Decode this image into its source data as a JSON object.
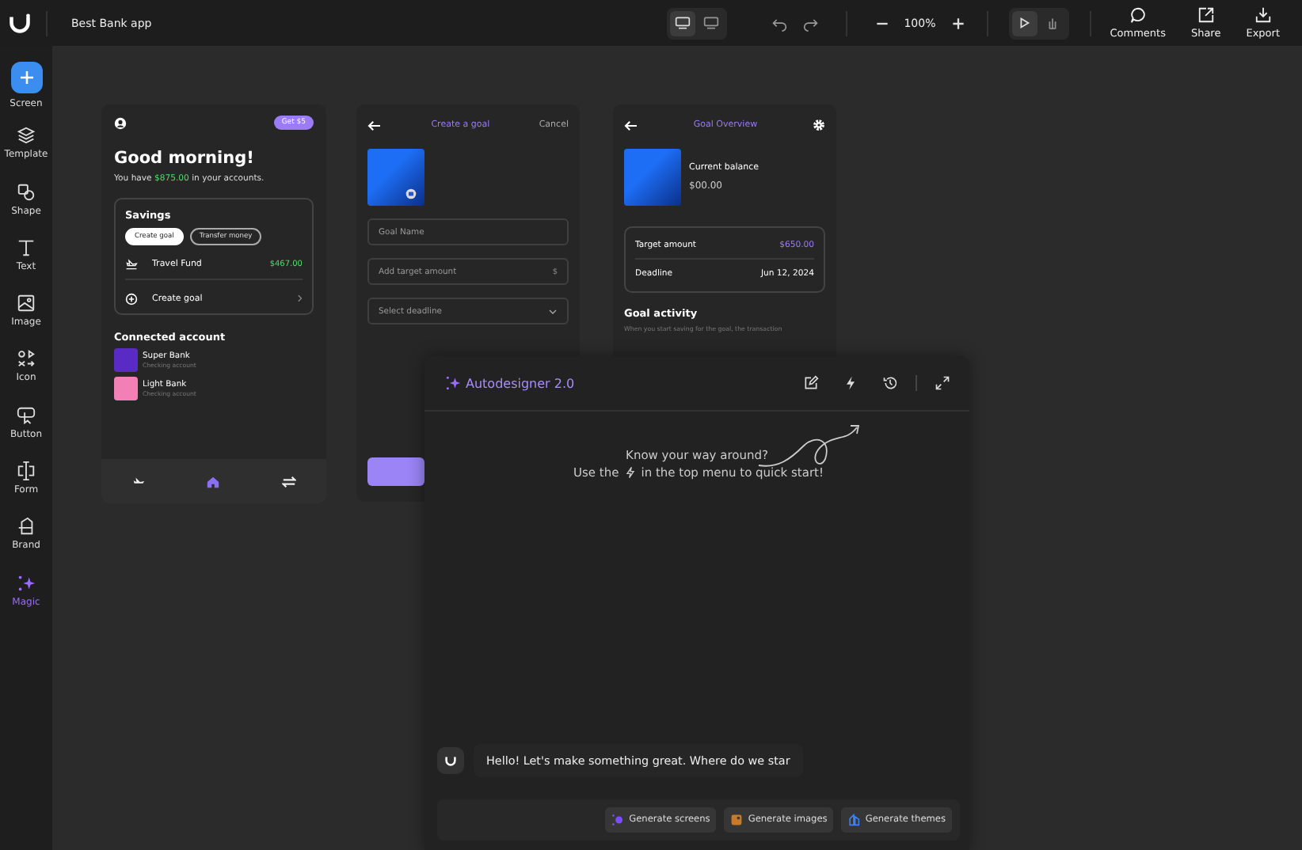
{
  "app": {
    "title": "Best Bank app"
  },
  "toolbar": {
    "views": [
      {
        "selected": true
      },
      {
        "selected": false
      }
    ],
    "zoom": "100%",
    "modes": [
      {
        "selected": true
      },
      {
        "selected": false
      }
    ],
    "actions": [
      {
        "label": "Comments"
      },
      {
        "label": "Share"
      },
      {
        "label": "Export"
      }
    ]
  },
  "sidebar": {
    "items": [
      {
        "label": "Screen",
        "selected": false
      },
      {
        "label": "Template",
        "selected": false
      },
      {
        "label": "Shape",
        "selected": false
      },
      {
        "label": "Text",
        "selected": false
      },
      {
        "label": "Image",
        "selected": false
      },
      {
        "label": "Icon",
        "selected": false
      },
      {
        "label": "Button",
        "selected": false
      },
      {
        "label": "Form",
        "selected": false
      },
      {
        "label": "Brand",
        "selected": false
      },
      {
        "label": "Magic",
        "selected": true
      }
    ]
  },
  "home_screen": {
    "badge": "Get $5",
    "greeting": "Good morning!",
    "balance_prefix": "You have ",
    "balance": "$875.00",
    "balance_suffix": " in your accounts.",
    "savings": {
      "title": "Savings",
      "chips": [
        {
          "label": "Create goal",
          "selected": true
        },
        {
          "label": "Transfer money",
          "selected": false
        }
      ],
      "goal": {
        "name": "Travel Fund",
        "amount": "$467.00"
      },
      "create": "Create goal"
    },
    "connected_title": "Connected account",
    "accounts": [
      {
        "name": "Super Bank",
        "type": "Checking account",
        "color": "#5a2bc4"
      },
      {
        "name": "Light Bank",
        "type": "Checking account",
        "color": "#f27fb5"
      }
    ],
    "nav": [
      {
        "selected": false
      },
      {
        "selected": true
      },
      {
        "selected": false
      }
    ]
  },
  "create_goal_screen": {
    "title": "Create a goal",
    "cancel": "Cancel",
    "fields": [
      {
        "placeholder": "Goal Name",
        "kind": "text"
      },
      {
        "placeholder": "Add target amount",
        "suffix": "$",
        "kind": "amount"
      },
      {
        "placeholder": "Select deadline",
        "kind": "select"
      }
    ]
  },
  "goal_overview_screen": {
    "title": "Goal Overview",
    "balance_label": "Current balance",
    "balance": "$00.00",
    "details": [
      {
        "label": "Target amount",
        "value": "$650.00",
        "kind": "accent"
      },
      {
        "label": "Deadline",
        "value": "Jun 12, 2024",
        "kind": "plain"
      }
    ],
    "activity_title": "Goal activity",
    "activity_text": "When you start saving for the goal, the transaction"
  },
  "autodesigner": {
    "title": "Autodesigner 2.0",
    "hint_question": "Know your way around?",
    "hint_before": "Use the",
    "hint_after": "in the top menu to quick start!",
    "message": "Hello! Let's make something great. Where do we star",
    "suggestions": [
      {
        "label": "Generate screens",
        "kind": "screens"
      },
      {
        "label": "Generate images",
        "kind": "images"
      },
      {
        "label": "Generate themes",
        "kind": "themes"
      }
    ]
  }
}
